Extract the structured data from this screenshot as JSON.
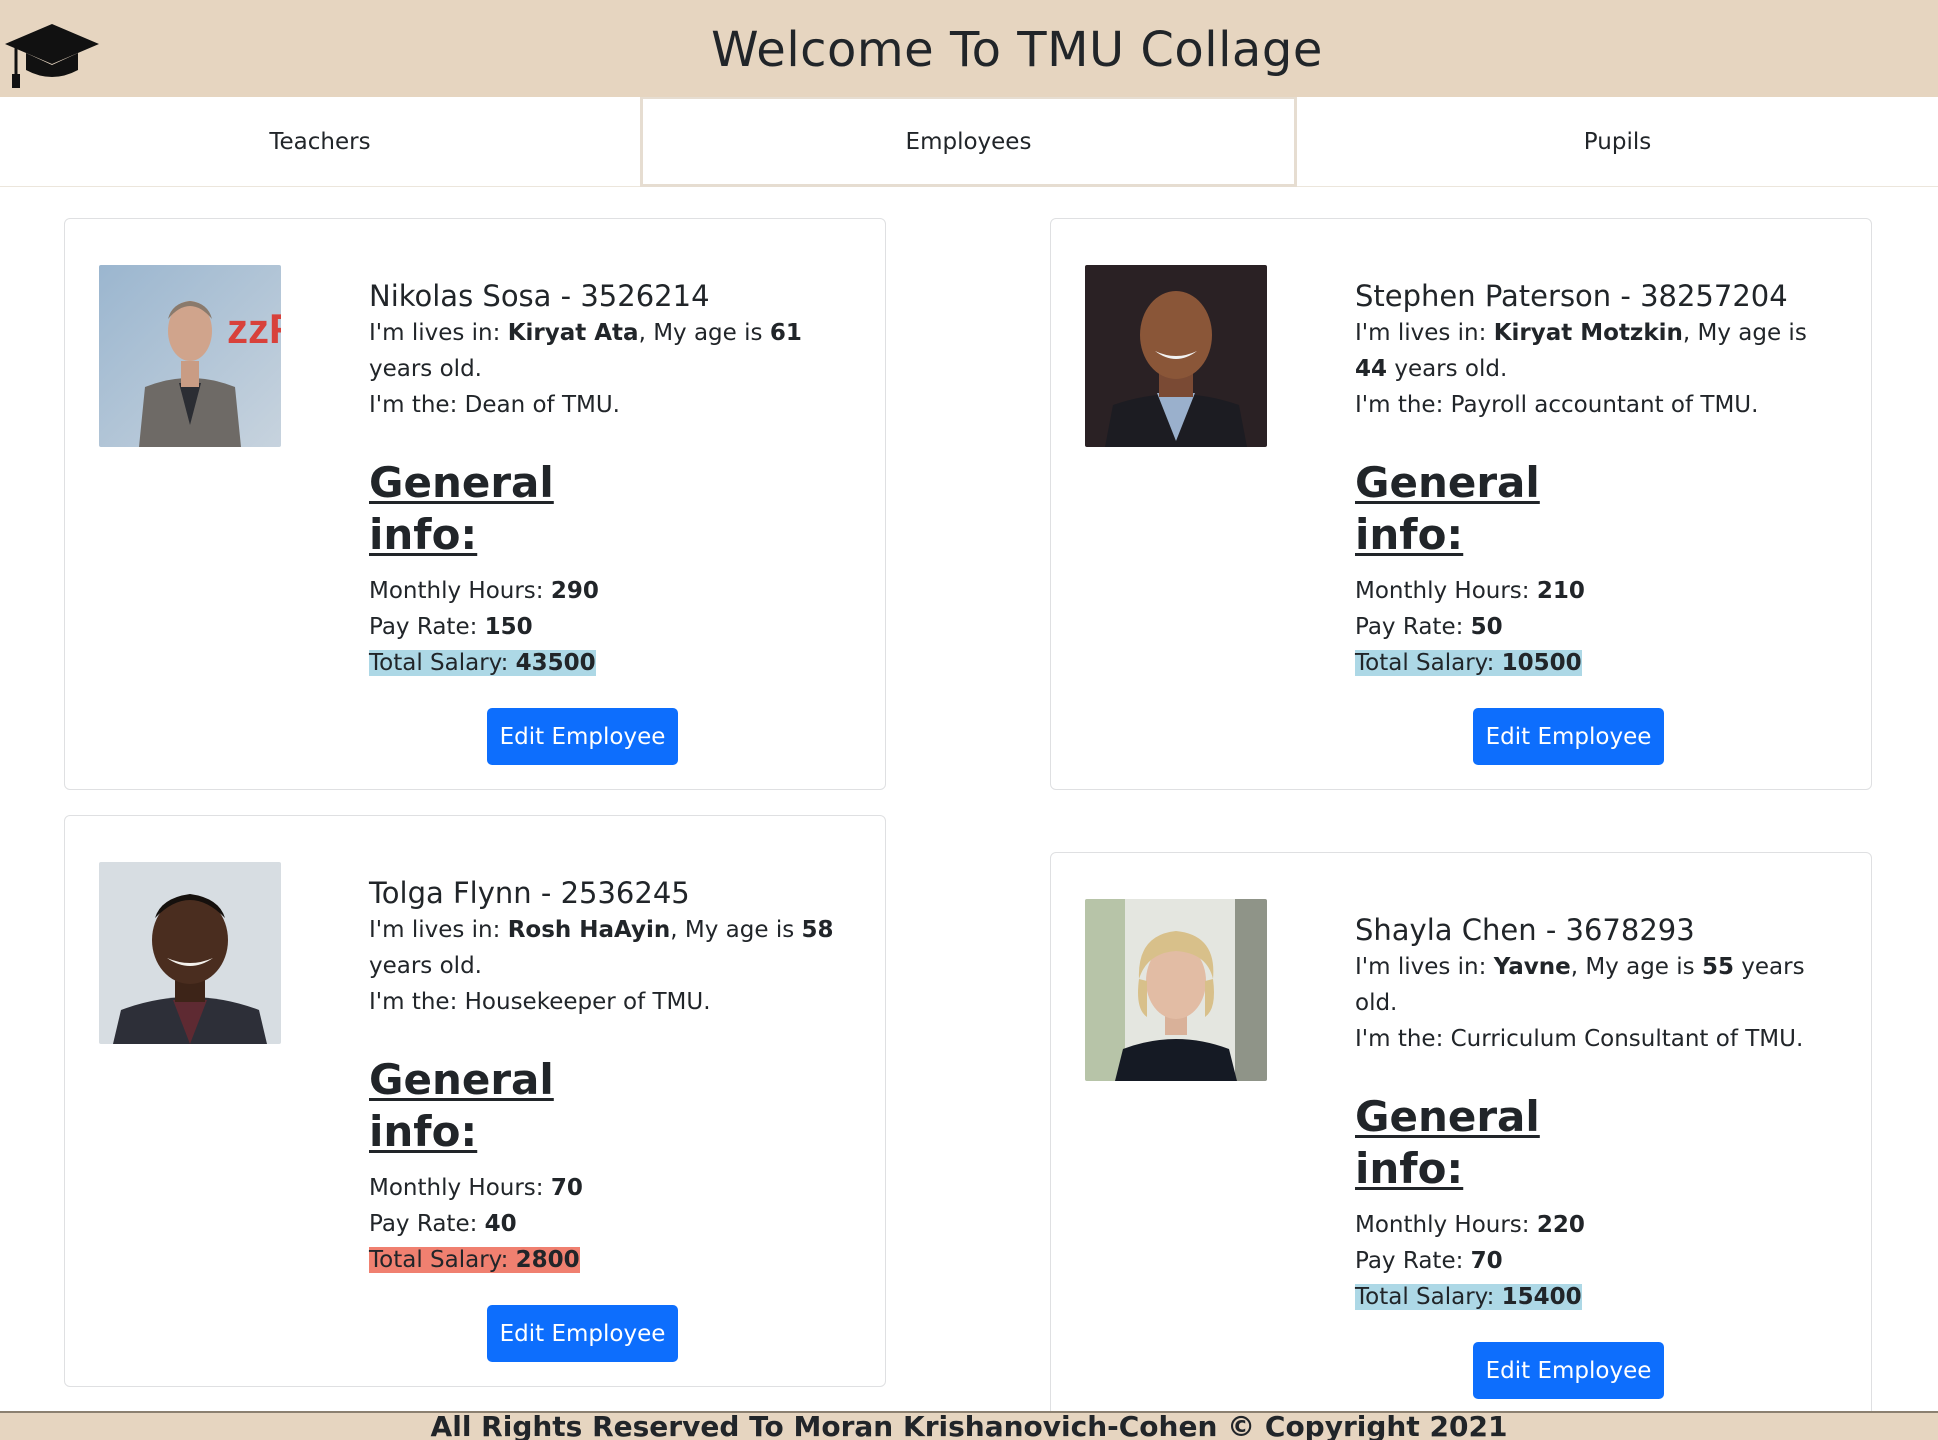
{
  "header": {
    "title": "Welcome To TMU Collage",
    "logo_icon": "graduation-cap-icon"
  },
  "tabs": [
    {
      "label": "Teachers",
      "active": false
    },
    {
      "label": "Employees",
      "active": true
    },
    {
      "label": "Pupils",
      "active": false
    }
  ],
  "employees": [
    {
      "name": "Nikolas Sosa",
      "id": "3526214",
      "lives_prefix": "I'm lives in: ",
      "city": "Kiryat Ata",
      "age_prefix": ", My age is ",
      "age": "61",
      "age_suffix": " years old.",
      "role_line": "I'm the: Dean of TMU.",
      "general_title": "General info:",
      "hours_label": "Monthly Hours: ",
      "hours": "290",
      "rate_label": "Pay Rate: ",
      "rate": "150",
      "salary_label": "Total Salary: ",
      "salary": "43500",
      "salary_color": "#add8e6",
      "button": "Edit Employee"
    },
    {
      "name": "Stephen Paterson",
      "id": "38257204",
      "lives_prefix": "I'm lives in: ",
      "city": "Kiryat Motzkin",
      "age_prefix": ", My age is ",
      "age": "44",
      "age_suffix": " years old.",
      "role_line": "I'm the: Payroll accountant of TMU.",
      "general_title": "General info:",
      "hours_label": "Monthly Hours: ",
      "hours": "210",
      "rate_label": "Pay Rate: ",
      "rate": "50",
      "salary_label": "Total Salary: ",
      "salary": "10500",
      "salary_color": "#add8e6",
      "button": "Edit Employee"
    },
    {
      "name": "Tolga Flynn",
      "id": "2536245",
      "lives_prefix": "I'm lives in: ",
      "city": "Rosh HaAyin",
      "age_prefix": ", My age is ",
      "age": "58",
      "age_suffix": " years old.",
      "role_line": "I'm the: Housekeeper of TMU.",
      "general_title": "General info:",
      "hours_label": "Monthly Hours: ",
      "hours": "70",
      "rate_label": "Pay Rate: ",
      "rate": "40",
      "salary_label": "Total Salary: ",
      "salary": "2800",
      "salary_color": "#f08070",
      "button": "Edit Employee"
    },
    {
      "name": "Shayla Chen",
      "id": "3678293",
      "lives_prefix": "I'm lives in: ",
      "city": "Yavne",
      "age_prefix": ", My age is ",
      "age": "55",
      "age_suffix": " years old.",
      "role_line": "I'm the: Curriculum Consultant of TMU.",
      "general_title": "General info:",
      "hours_label": "Monthly Hours: ",
      "hours": "220",
      "rate_label": "Pay Rate: ",
      "rate": "70",
      "salary_label": "Total Salary: ",
      "salary": "15400",
      "salary_color": "#add8e6",
      "button": "Edit Employee"
    }
  ],
  "footer": {
    "text": "All Rights Reserved To Moran Krishanovich-Cohen © Copyright 2021"
  }
}
